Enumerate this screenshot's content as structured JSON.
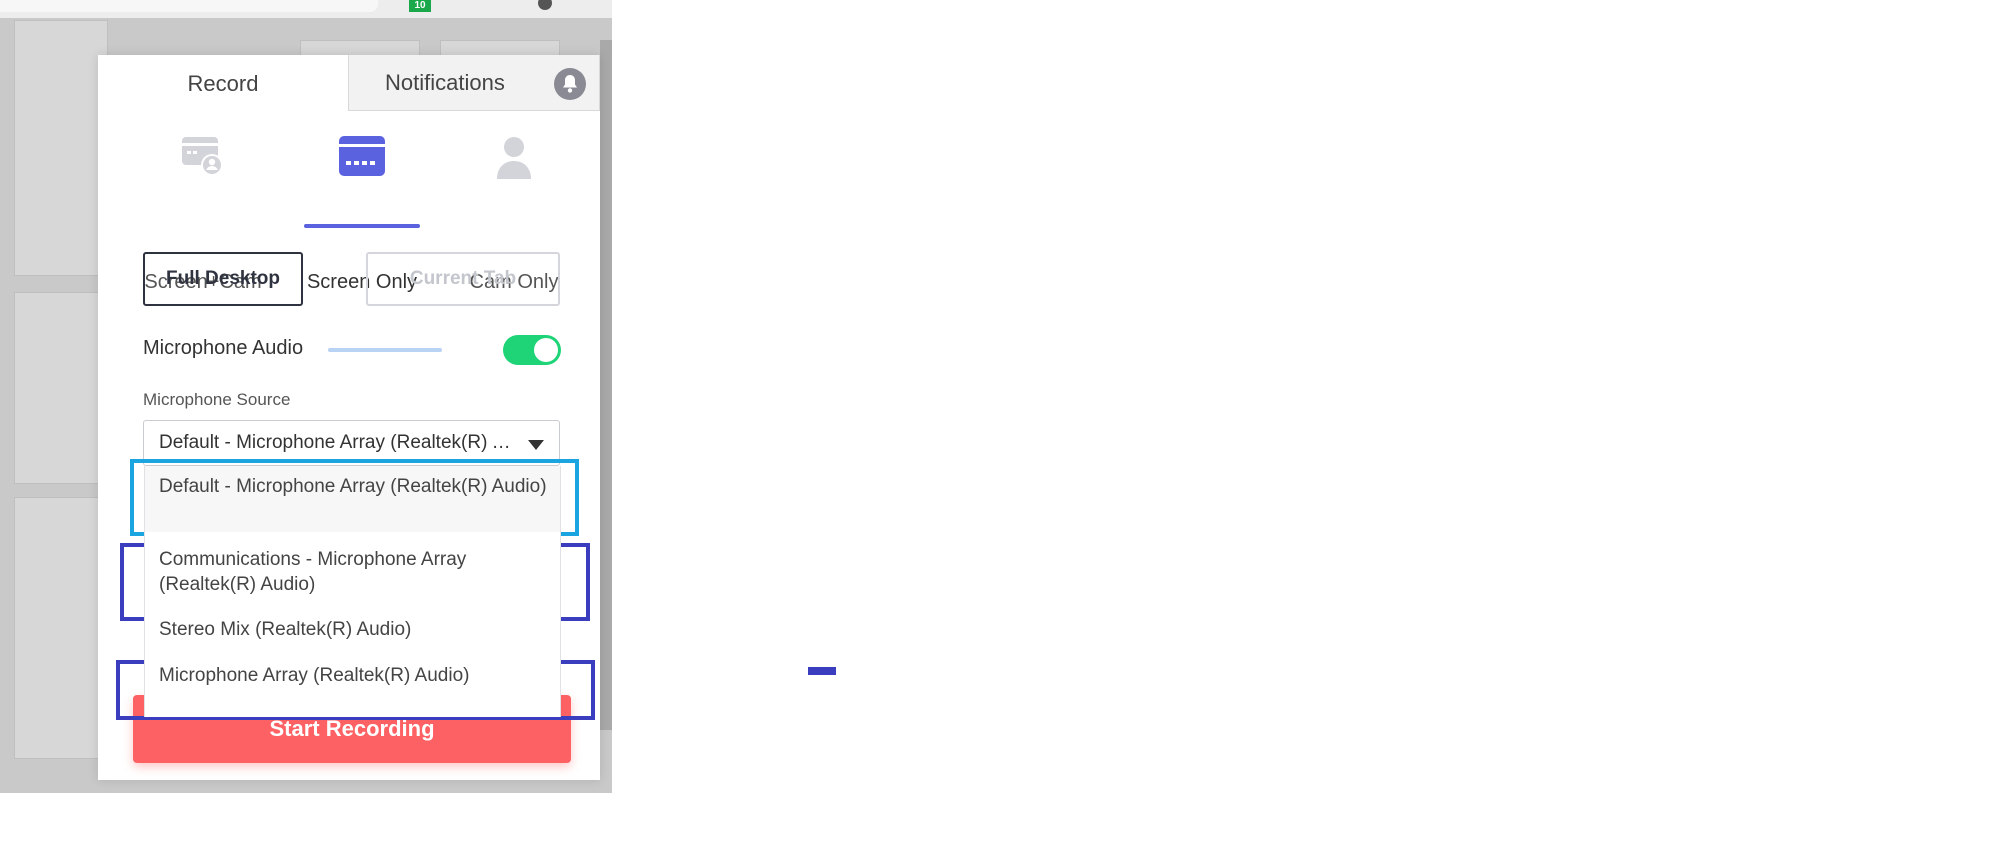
{
  "browser": {
    "extension_badge": "10"
  },
  "popup": {
    "tabs": {
      "record_label": "Record",
      "notifications_label": "Notifications"
    },
    "modes": [
      {
        "label": "Screen+Cam",
        "icon": "screen-cam-icon"
      },
      {
        "label": "Screen Only",
        "icon": "screen-only-icon",
        "active": true
      },
      {
        "label": "Cam Only",
        "icon": "cam-only-icon"
      }
    ],
    "capture": {
      "full_desktop_label": "Full Desktop",
      "current_tab_label": "Current Tab"
    },
    "microphone": {
      "label": "Microphone Audio",
      "enabled": true,
      "source_label": "Microphone Source",
      "selected": "Default - Microphone Array (Realtek(R) Audio)",
      "options": [
        "Default - Microphone Array (Realtek(R) Audio)",
        "Communications - Microphone Array (Realtek(R) Audio)",
        "Stereo Mix (Realtek(R) Audio)",
        "Microphone Array (Realtek(R) Audio)"
      ]
    },
    "start_label": "Start Recording"
  },
  "colors": {
    "accent": "#5a62e0",
    "start_button": "#fe6164",
    "toggle_on": "#1ed477",
    "highlight_cyan": "#1aa4e0",
    "highlight_blue": "#3b3dbf"
  }
}
